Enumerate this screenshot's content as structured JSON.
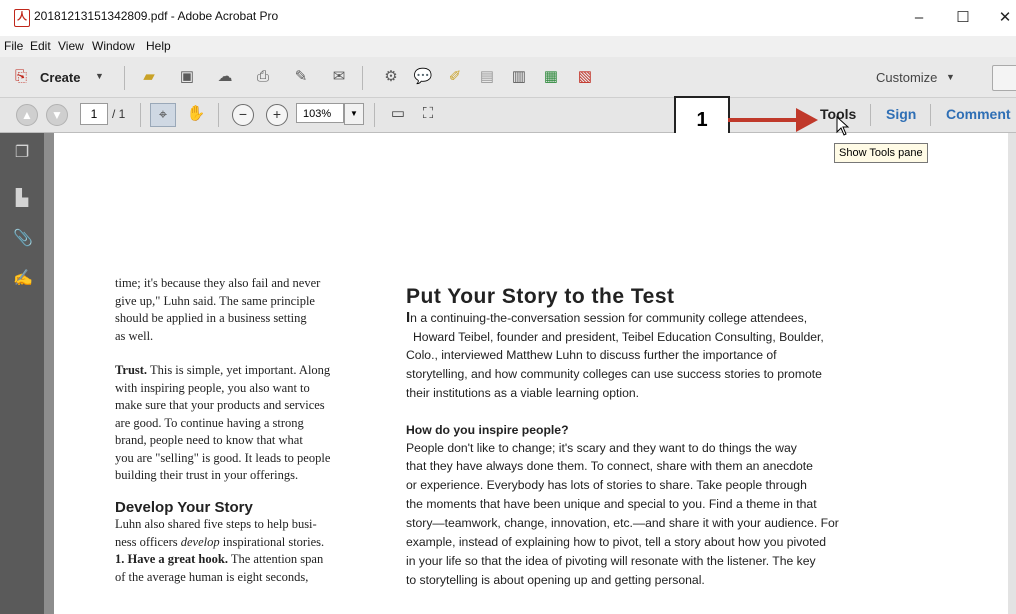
{
  "window": {
    "title": "20181213151342809.pdf - Adobe Acrobat Pro",
    "minimize": "–",
    "maximize": "☐",
    "close": "✕"
  },
  "menu": [
    "File",
    "Edit",
    "View",
    "Window",
    "Help"
  ],
  "toolbar": {
    "create_label": "Create",
    "customize_label": "Customize",
    "icons": [
      "create-pdf-icon",
      "open-folder-icon",
      "save-icon",
      "cloud-upload-icon",
      "print-icon",
      "edit-icon",
      "email-icon",
      "settings-icon",
      "comment-icon",
      "highlight-icon",
      "document-icon",
      "document-search-icon",
      "document-export-icon",
      "document-edit-icon"
    ]
  },
  "nav": {
    "page_current": "1",
    "page_total": "/ 1",
    "zoom": "103%",
    "tools_label": "Tools",
    "sign_label": "Sign",
    "comment_label": "Comment"
  },
  "callout": {
    "number": "1",
    "arrow_color": "#c0392b"
  },
  "tooltip": "Show Tools pane",
  "left_column": {
    "para1": [
      "time; it's because they also fail and never",
      "give up,\" Luhn said. The same principle",
      "should be applied in a business setting",
      "as well."
    ],
    "trust_heading": "Trust.",
    "para2_first": " This is simple, yet important. Along",
    "para2": [
      "with inspiring people, you also want to",
      "make sure that your products and services",
      "are good. To continue having a strong",
      "brand, people need to know that what",
      "you are \"selling\" is good. It leads to people",
      "building their trust in your offerings."
    ],
    "heading2": "Develop Your Story",
    "para3_a": "Luhn also shared five steps to help busi-",
    "para3_b_pre": "ness officers ",
    "para3_b_em": "develop",
    "para3_b_post": " inspirational stories.",
    "hook_heading": "1. Have a great hook.",
    "hook_text": " The attention span",
    "para3_d": "of the average human is eight seconds,"
  },
  "right_column": {
    "heading": "Put Your Story to the Test",
    "intro_initial": "I",
    "intro": [
      "n a continuing-the-conversation session for community college attendees,",
      "Howard Teibel, founder and president, Teibel Education Consulting, Boulder,",
      "Colo., interviewed Matthew Luhn to discuss further the importance of",
      "storytelling, and how community colleges can use success stories to promote",
      "their institutions as a viable learning option."
    ],
    "question": "How do you inspire people?",
    "answer": [
      "People don't like to change; it's scary and they want to do things the way",
      "that they have always done them. To connect, share with them an anecdote",
      "or experience. Everybody has lots of stories to share. Take people through",
      "the moments that have been unique and special to you. Find a theme in that",
      "story—teamwork, change, innovation, etc.—and share it with your audience. For",
      "example, instead of explaining how to pivot, tell a story about how you pivoted",
      "in your life so that the idea of pivoting will resonate with the listener. The key",
      "to storytelling is about opening up and getting personal."
    ]
  }
}
